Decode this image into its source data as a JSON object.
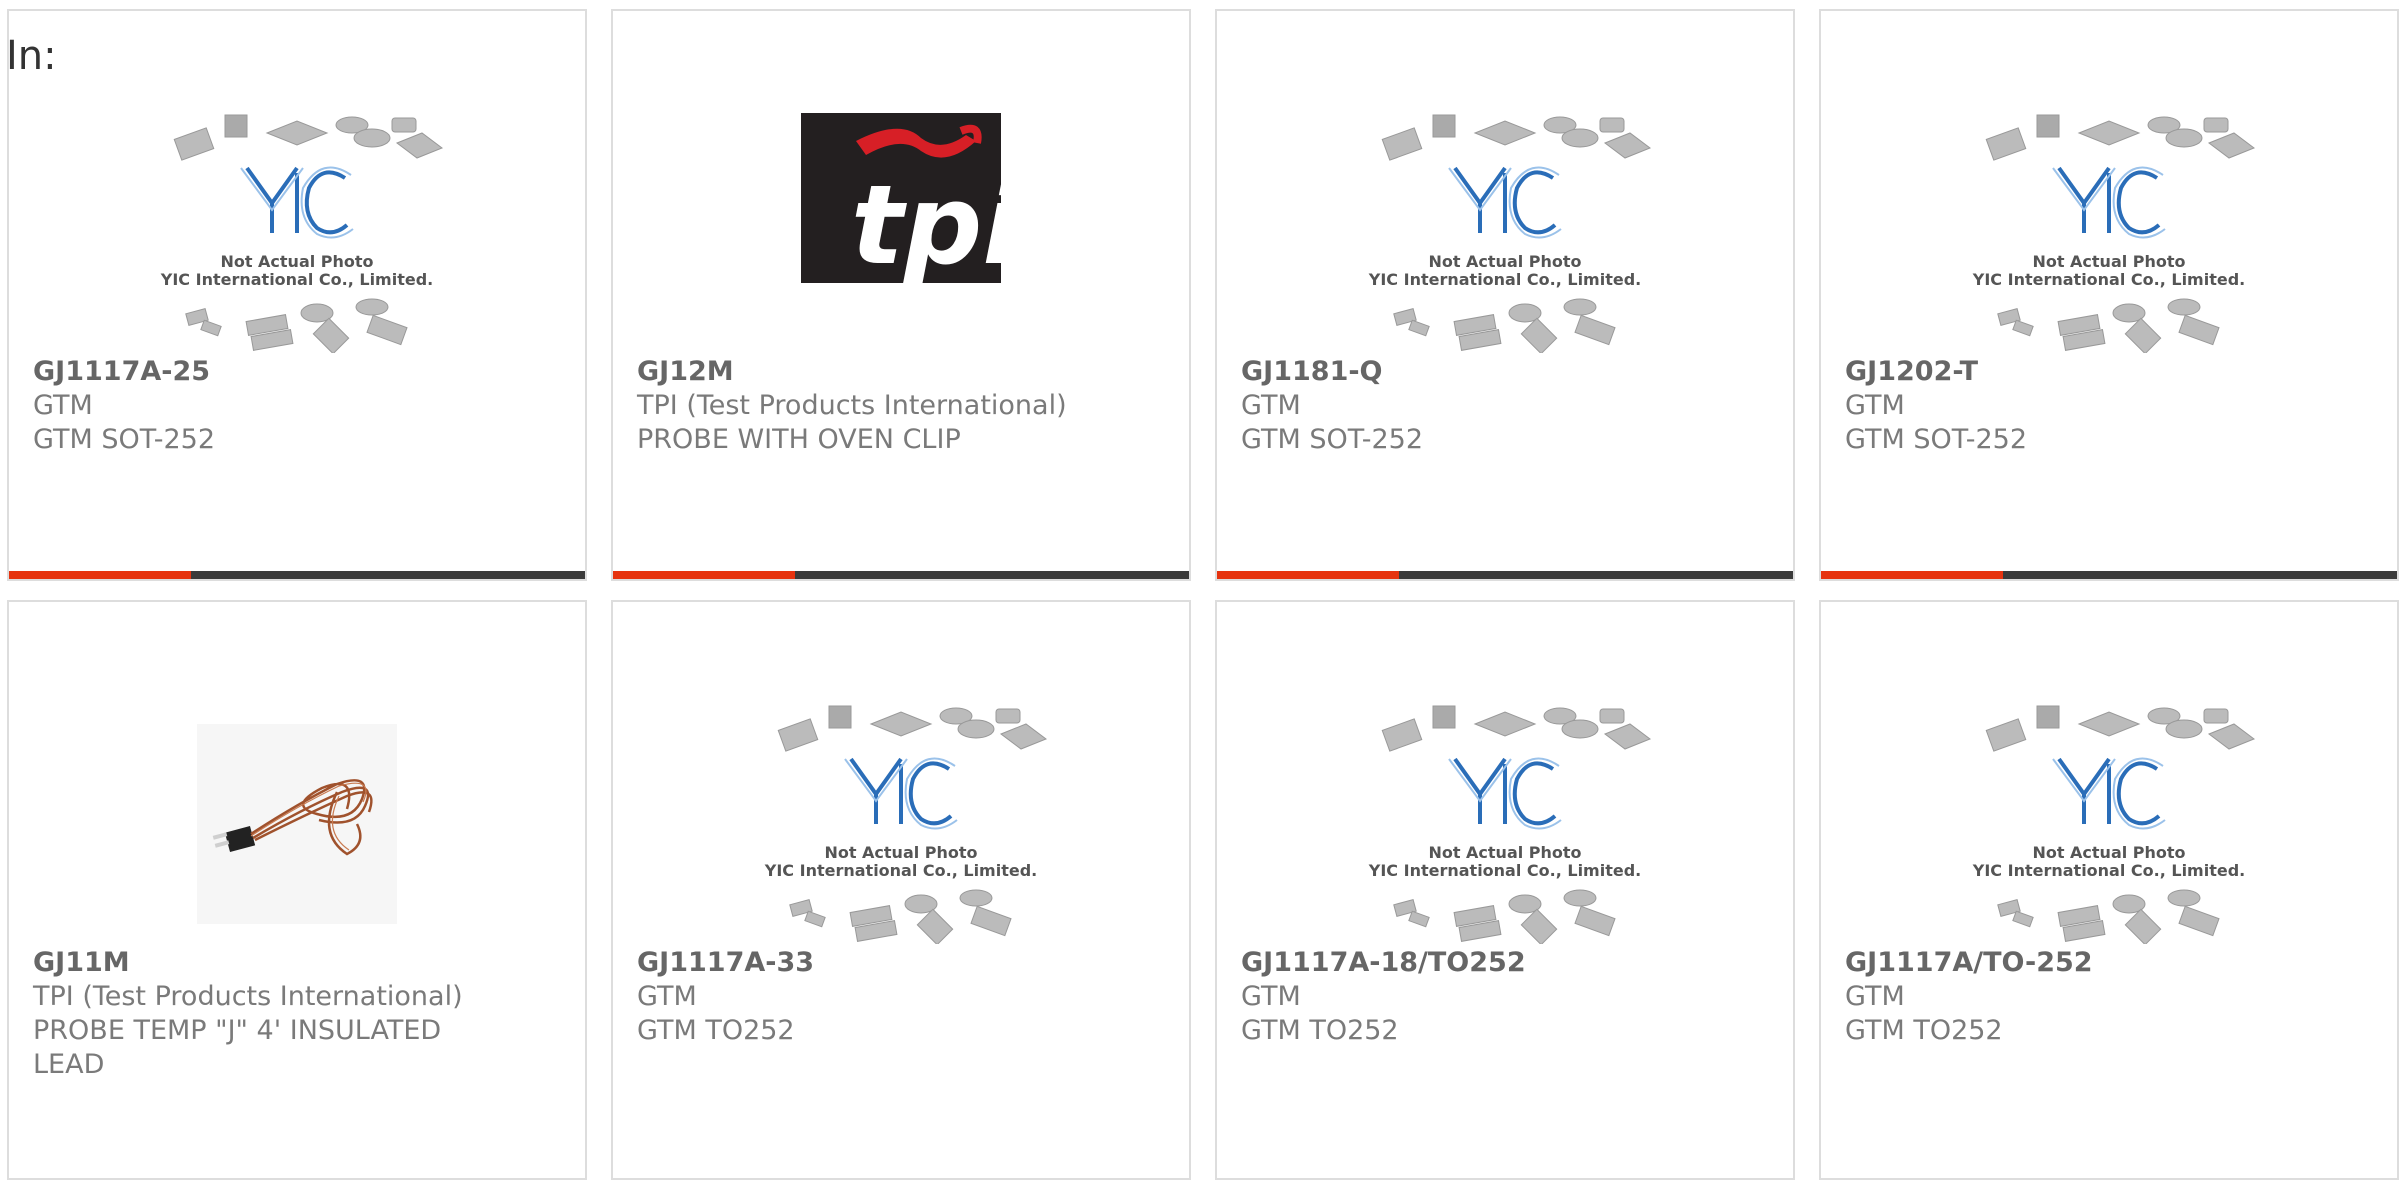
{
  "header": {
    "label": "In:"
  },
  "image_placeholder": {
    "line1": "Not Actual Photo",
    "line2": "YIC International Co., Limited."
  },
  "tpi_logo_text": "tpi",
  "accent_color": "#e6330f",
  "bar_color": "#3a3a3a",
  "products": [
    {
      "part": "GJ1117A-25",
      "maker": "GTM",
      "desc": "GTM SOT-252",
      "image": "yic-placeholder"
    },
    {
      "part": "GJ12M",
      "maker": "TPI (Test Products International)",
      "desc": "PROBE WITH OVEN CLIP",
      "image": "tpi-logo"
    },
    {
      "part": "GJ1181-Q",
      "maker": "GTM",
      "desc": "GTM SOT-252",
      "image": "yic-placeholder"
    },
    {
      "part": "GJ1202-T",
      "maker": "GTM",
      "desc": "GTM SOT-252",
      "image": "yic-placeholder"
    },
    {
      "part": "GJ11M",
      "maker": "TPI (Test Products International)",
      "desc": "PROBE TEMP \"J\" 4' INSULATED LEAD",
      "image": "probe-photo"
    },
    {
      "part": "GJ1117A-33",
      "maker": "GTM",
      "desc": "GTM TO252",
      "image": "yic-placeholder"
    },
    {
      "part": "GJ1117A-18/TO252",
      "maker": "GTM",
      "desc": "GTM TO252",
      "image": "yic-placeholder"
    },
    {
      "part": "GJ1117A/TO-252",
      "maker": "GTM",
      "desc": "GTM TO252",
      "image": "yic-placeholder"
    }
  ]
}
